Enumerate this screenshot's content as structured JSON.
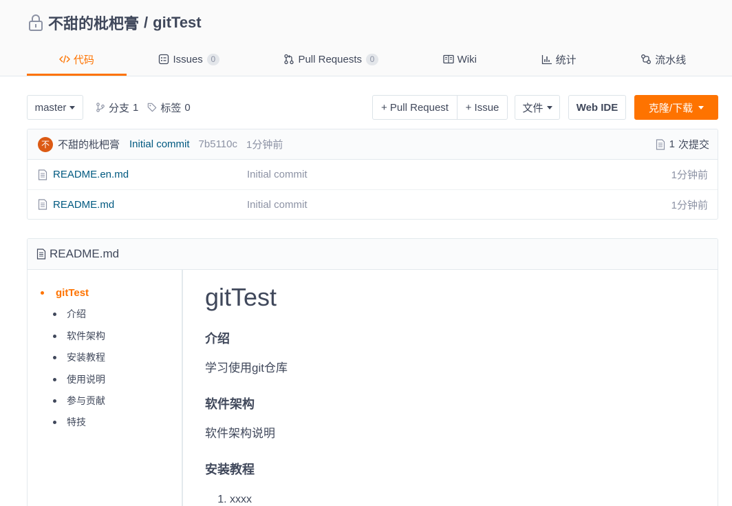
{
  "theme": {
    "accent": "#fe7300",
    "link": "#005980",
    "text": "#40485b",
    "muted": "#8c92a4",
    "border": "#e3e9ed",
    "panel": "#fafbfc",
    "avatar": "#dc5a14"
  },
  "repo": {
    "visibility_icon": "lock-icon",
    "owner": "不甜的枇杷膏",
    "separator": "/",
    "name": "gitTest"
  },
  "tabs": [
    {
      "label": "代码",
      "icon": "code-icon",
      "active": true
    },
    {
      "label": "Issues",
      "icon": "issues-icon",
      "count": "0"
    },
    {
      "label": "Pull Requests",
      "icon": "pull-request-icon",
      "count": "0"
    },
    {
      "label": "Wiki",
      "icon": "wiki-icon"
    },
    {
      "label": "统计",
      "icon": "stats-icon"
    },
    {
      "label": "流水线",
      "icon": "pipeline-icon"
    }
  ],
  "toolbar": {
    "branch": "master",
    "branches_label": "分支",
    "branches_count": "1",
    "tags_label": "标签",
    "tags_count": "0",
    "new_pull_request": "+ Pull Request",
    "new_issue": "+ Issue",
    "file_menu": "文件",
    "web_ide": "Web IDE",
    "clone_download": "克隆/下载"
  },
  "last_commit": {
    "avatar_text": "不",
    "author": "不甜的枇杷膏",
    "message": "Initial commit",
    "sha": "7b5110c",
    "time": "1分钟前",
    "commits_count": "1",
    "commits_label": "次提交"
  },
  "files": [
    {
      "name": "README.en.md",
      "icon": "file-icon",
      "commit_message": "Initial commit",
      "time": "1分钟前"
    },
    {
      "name": "README.md",
      "icon": "file-icon",
      "commit_message": "Initial commit",
      "time": "1分钟前"
    }
  ],
  "readme": {
    "filename": "README.md",
    "toc": [
      {
        "label": "gitTest",
        "active": true,
        "children": [
          "介绍",
          "软件架构",
          "安装教程",
          "使用说明",
          "参与贡献",
          "特技"
        ]
      }
    ],
    "title": "gitTest",
    "sections": [
      {
        "heading": "介绍",
        "text": "学习使用git仓库"
      },
      {
        "heading": "软件架构",
        "text": "软件架构说明"
      },
      {
        "heading": "安装教程",
        "list": [
          "xxxx"
        ]
      }
    ]
  }
}
